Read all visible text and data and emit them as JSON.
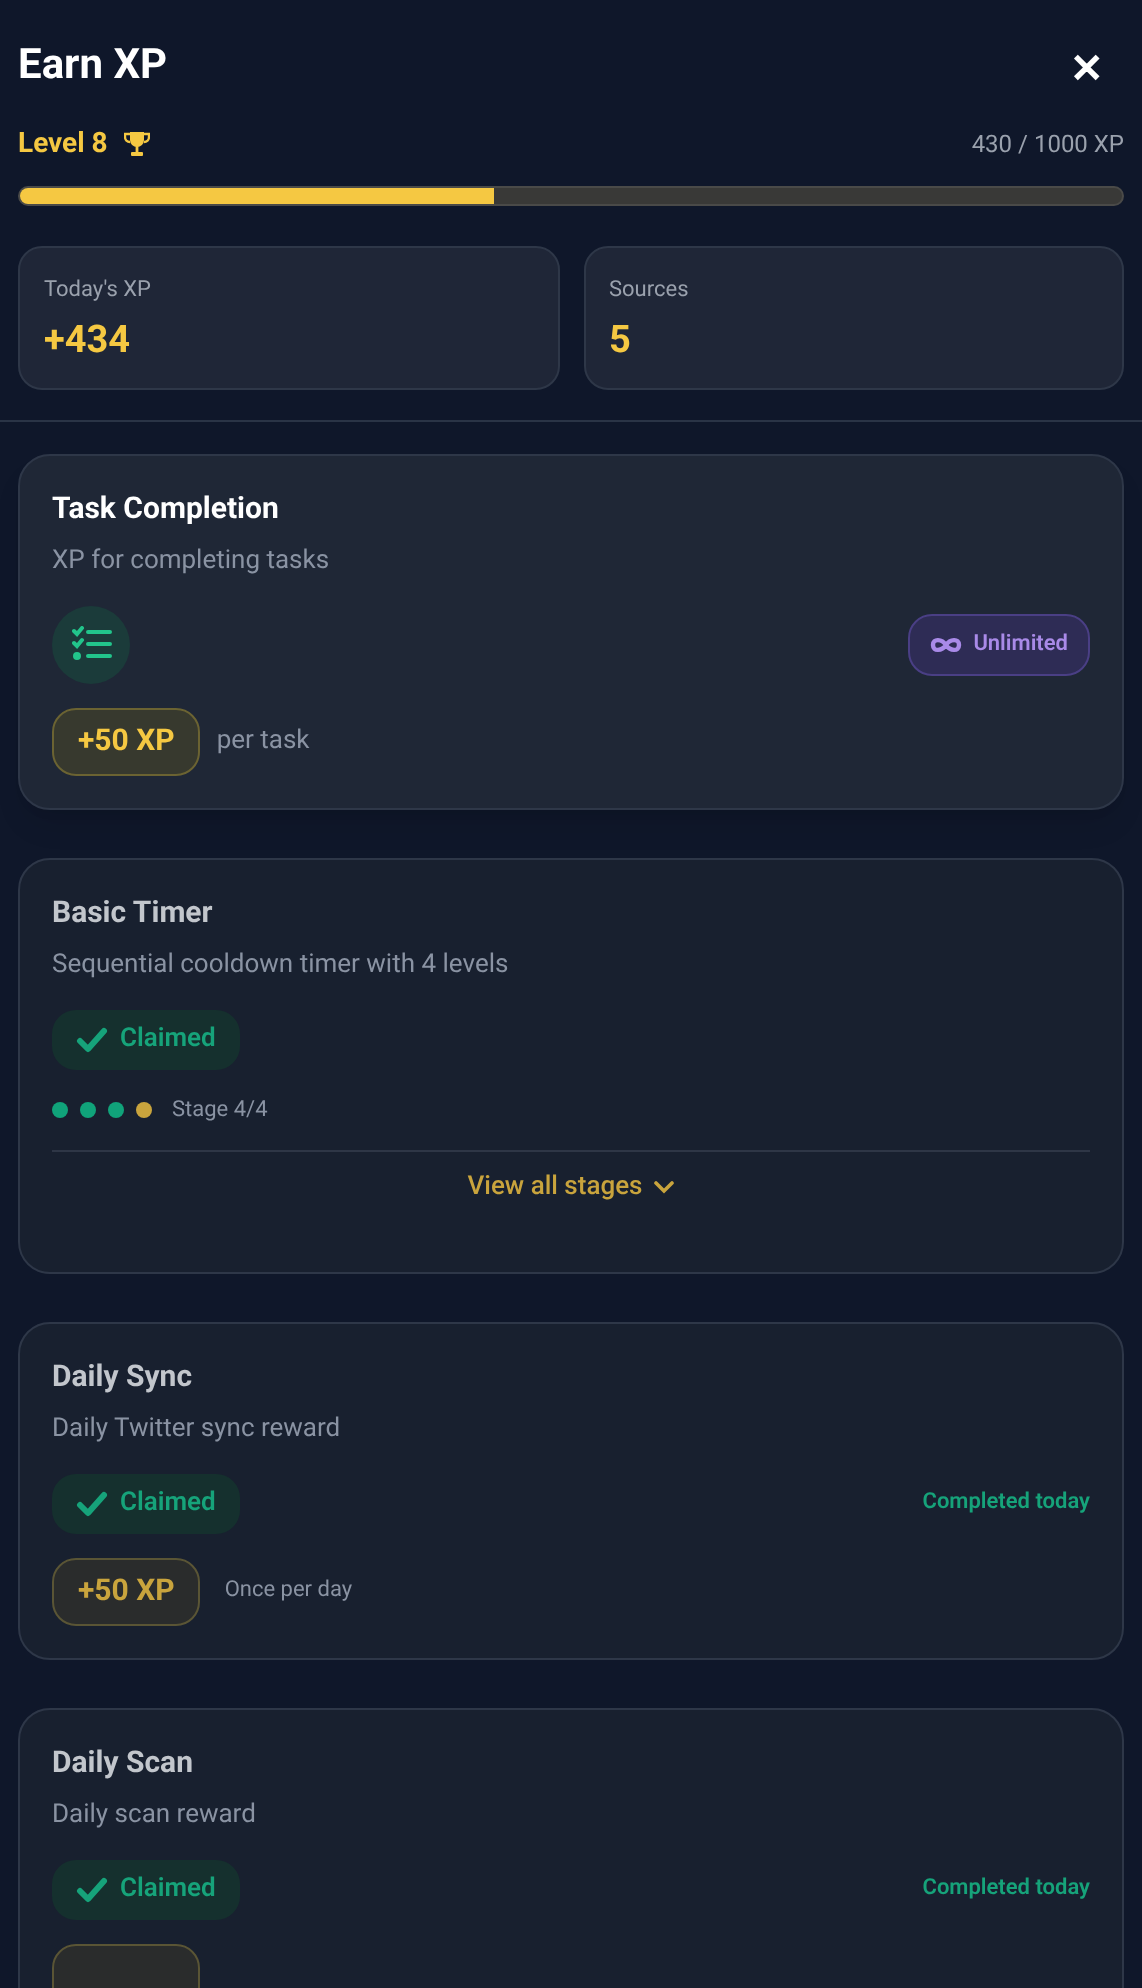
{
  "header": {
    "title": "Earn XP",
    "close": "✕"
  },
  "level": {
    "label": "Level 8",
    "progress": "430 / 1000 XP",
    "level": 0.43
  },
  "stats": [
    {
      "label": "Today's XP",
      "value": "+434"
    },
    {
      "label": "Sources",
      "value": "5"
    }
  ],
  "cards": [
    {
      "kind": "task",
      "title": "Task Completion",
      "description": "XP for completing tasks",
      "claimed": false,
      "badge": "Unlimited",
      "xp": "+50 XP",
      "note": "per task"
    },
    {
      "kind": "stages",
      "title": "Basic Timer",
      "description": "Sequential cooldown timer with 4 levels",
      "claimed": true,
      "claimed_label": "Claimed",
      "dots": [
        {
          "color": "#10a37a"
        },
        {
          "color": "#10a37a"
        },
        {
          "color": "#10a37a"
        },
        {
          "color": "#c9a43d"
        }
      ],
      "stage": "Stage 4/4",
      "link": "View all stages"
    },
    {
      "kind": "daily",
      "title": "Daily Sync",
      "description": "Daily Twitter sync reward",
      "claimed": true,
      "claimed_label": "Claimed",
      "status": "Completed today",
      "xp": "+50 XP",
      "note": "Once per day"
    },
    {
      "kind": "daily",
      "title": "Daily Scan",
      "description": "Daily scan reward",
      "claimed": true,
      "claimed_label": "Claimed",
      "status": "Completed today"
    }
  ]
}
